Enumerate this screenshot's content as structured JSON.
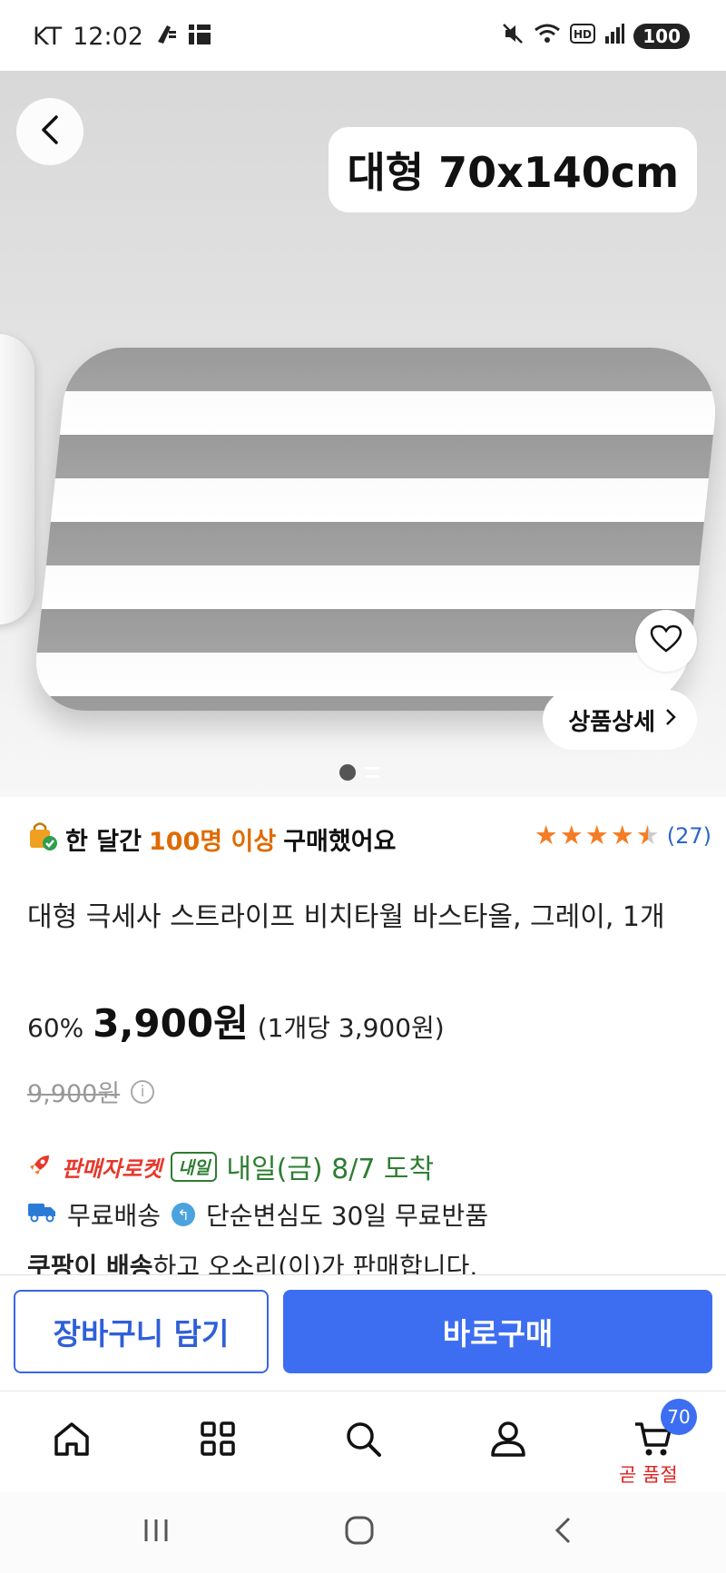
{
  "status_bar": {
    "carrier": "KT",
    "time": "12:02",
    "battery": "100",
    "icons": [
      "mute-icon",
      "wifi-icon",
      "hd-icon",
      "signal-icon"
    ]
  },
  "hero": {
    "size_label": "대형 70x140cm",
    "detail_button": "상품상세",
    "page_count": 2,
    "current_page": 1
  },
  "purchase": {
    "prefix": "한 달간",
    "highlight": "100명 이상",
    "suffix": "구매했어요",
    "rating": 4.5,
    "review_count": "(27)"
  },
  "product": {
    "title": "대형 극세사 스트라이프 비치타월 바스타올, 그레이, 1개",
    "discount": "60%",
    "price": "3,900원",
    "unit_price": "(1개당 3,900원)",
    "original_price": "9,900원"
  },
  "delivery": {
    "rocket_label": "판매자로켓",
    "tomorrow_badge": "내일",
    "arrival": "내일(금) 8/7 도착",
    "free_shipping": "무료배송",
    "free_return": "단순변심도 30일 무료반품",
    "seller_bold": "쿠팡이 배송",
    "seller_rest": "하고 오소리(이)가 판매합니다."
  },
  "actions": {
    "add_to_cart": "장바구니 담기",
    "buy_now": "바로구매"
  },
  "bottom_nav": {
    "items": [
      "home-icon",
      "category-icon",
      "search-icon",
      "user-icon",
      "cart-icon"
    ],
    "cart_count": "70",
    "cart_status": "곧 품절"
  },
  "colors": {
    "accent_blue": "#3d6ef2",
    "highlight_orange": "#e06a00",
    "rocket_red": "#e8372b",
    "arrival_green": "#2e7d32",
    "star_orange": "#f57c24"
  }
}
